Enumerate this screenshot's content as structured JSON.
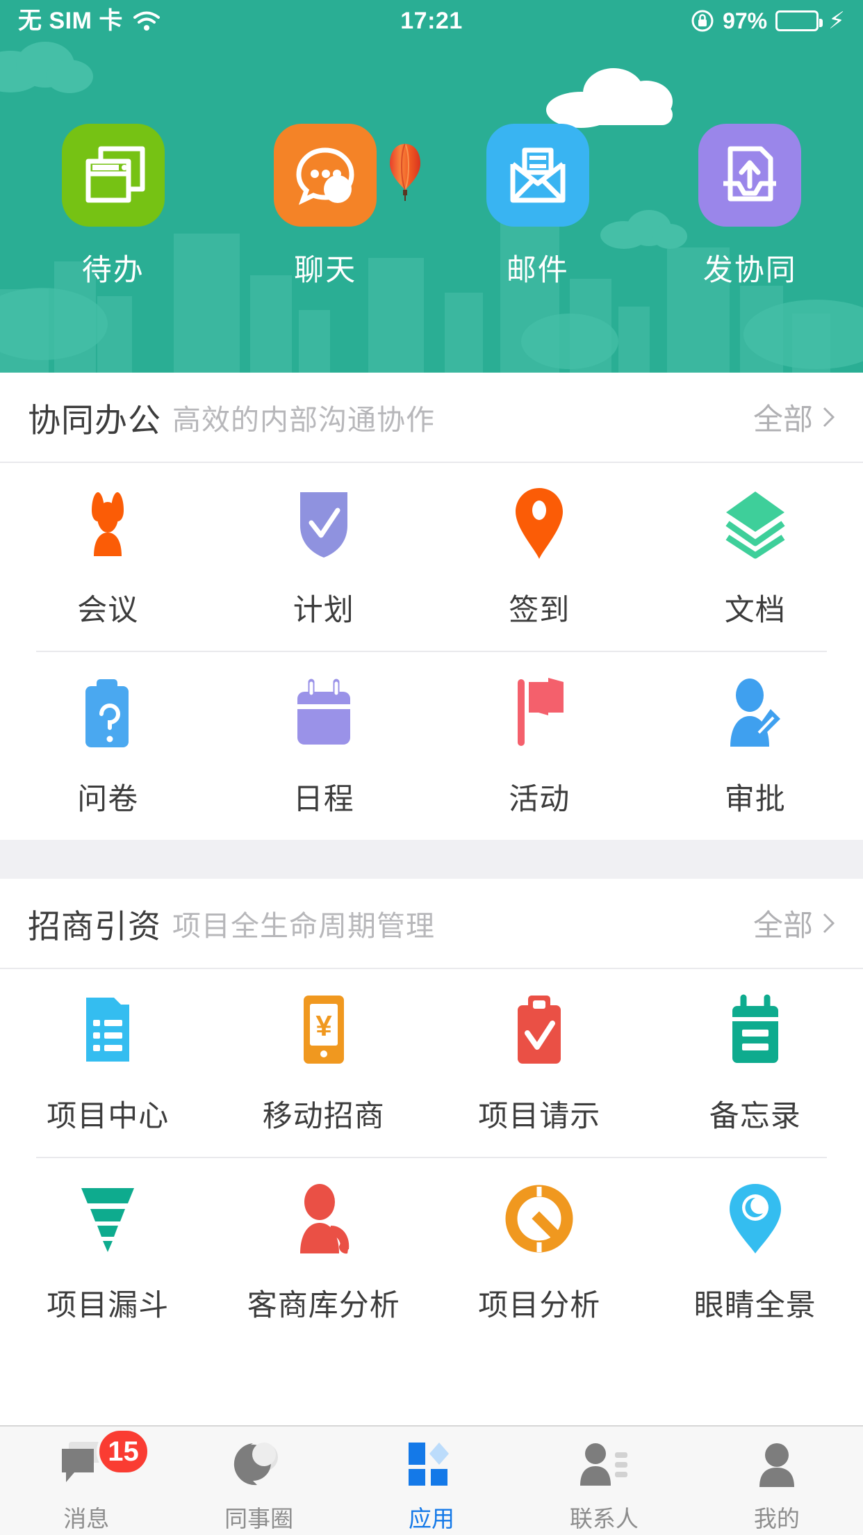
{
  "statusbar": {
    "carrier": "无 SIM 卡",
    "wifi_icon": "wifi-icon",
    "time": "17:21",
    "rotation_lock_icon": "rotation-lock-icon",
    "battery_percent": "97%",
    "battery_level": 97,
    "charging_icon": "charging-bolt-icon"
  },
  "hero": {
    "background_color": "#2aae94",
    "decorations": [
      "cloud",
      "hot-air-balloon",
      "city-skyline"
    ],
    "shortcuts": [
      {
        "label": "待办",
        "icon": "windows-stack-icon",
        "color": "#76c214"
      },
      {
        "label": "聊天",
        "icon": "chat-bubble-icon",
        "color": "#f48327"
      },
      {
        "label": "邮件",
        "icon": "envelope-icon",
        "color": "#39b4f2"
      },
      {
        "label": "发协同",
        "icon": "outbox-upload-icon",
        "color": "#9a86ea"
      }
    ]
  },
  "sections": [
    {
      "title": "协同办公",
      "subtitle": "高效的内部沟通协作",
      "all_label": "全部",
      "chevron_icon": "chevron-right-icon",
      "rows": [
        [
          {
            "label": "会议",
            "icon": "people-group-icon",
            "color": "#fb5c06"
          },
          {
            "label": "计划",
            "icon": "shield-check-icon",
            "color": "#8f92df"
          },
          {
            "label": "签到",
            "icon": "map-pin-icon",
            "color": "#fb5c06"
          },
          {
            "label": "文档",
            "icon": "layers-icon",
            "color": "#3ecf9a"
          }
        ],
        [
          {
            "label": "问卷",
            "icon": "clipboard-question-icon",
            "color": "#4aa8f0"
          },
          {
            "label": "日程",
            "icon": "calendar-icon",
            "color": "#9a92e8"
          },
          {
            "label": "活动",
            "icon": "flag-icon",
            "color": "#f4606c"
          },
          {
            "label": "审批",
            "icon": "person-pencil-icon",
            "color": "#3fa0ef"
          }
        ]
      ]
    },
    {
      "title": "招商引资",
      "subtitle": "项目全生命周期管理",
      "all_label": "全部",
      "chevron_icon": "chevron-right-icon",
      "rows": [
        [
          {
            "label": "项目中心",
            "icon": "document-list-icon",
            "color": "#34bdf0"
          },
          {
            "label": "移动招商",
            "icon": "mobile-yuan-icon",
            "color": "#f0981f"
          },
          {
            "label": "项目请示",
            "icon": "clipboard-check-icon",
            "color": "#ea5045"
          },
          {
            "label": "备忘录",
            "icon": "notepad-icon",
            "color": "#0eab8e"
          }
        ],
        [
          {
            "label": "项目漏斗",
            "icon": "funnel-icon",
            "color": "#0eab8e"
          },
          {
            "label": "客商库分析",
            "icon": "person-phone-icon",
            "color": "#ea5045"
          },
          {
            "label": "项目分析",
            "icon": "donut-chart-icon",
            "color": "#f0981f"
          },
          {
            "label": "眼睛全景",
            "icon": "eye-pin-icon",
            "color": "#34bdf0"
          }
        ]
      ]
    }
  ],
  "tabbar": {
    "active_color": "#1479e8",
    "items": [
      {
        "label": "消息",
        "icon": "messages-icon",
        "badge": "15",
        "active": false
      },
      {
        "label": "同事圈",
        "icon": "moments-icon",
        "badge": "",
        "active": false
      },
      {
        "label": "应用",
        "icon": "apps-grid-icon",
        "badge": "",
        "active": true
      },
      {
        "label": "联系人",
        "icon": "contacts-icon",
        "badge": "",
        "active": false
      },
      {
        "label": "我的",
        "icon": "profile-icon",
        "badge": "",
        "active": false
      }
    ]
  }
}
